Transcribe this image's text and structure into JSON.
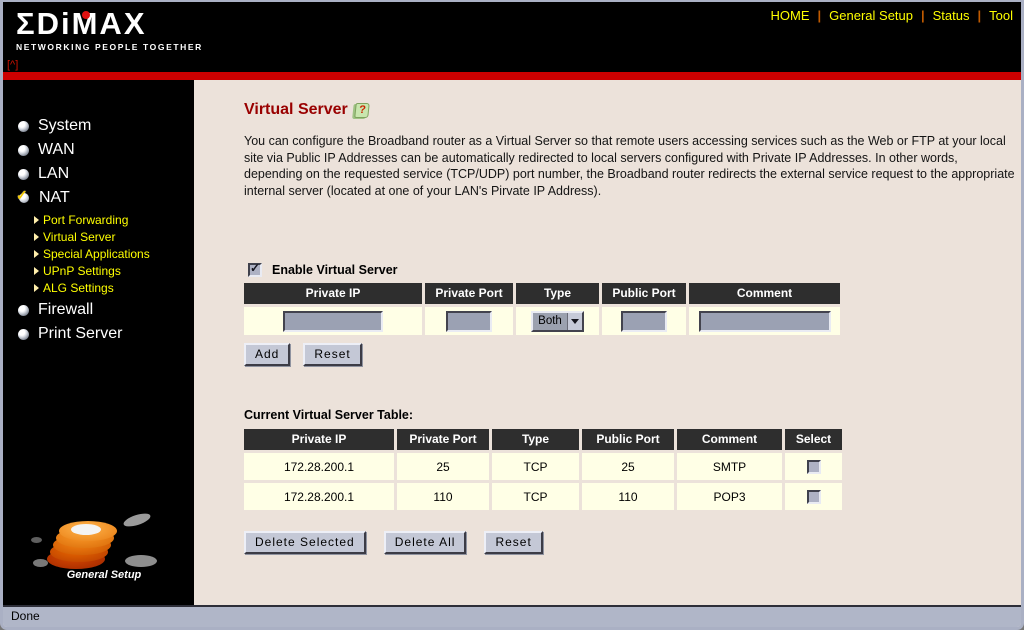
{
  "header": {
    "logo_text": "ΣDiMAX",
    "logo_tagline": "NETWORKING PEOPLE TOGETHER",
    "top_link": "[^]",
    "nav_separator": "|",
    "nav": [
      {
        "label": "HOME"
      },
      {
        "label": "General Setup"
      },
      {
        "label": "Status"
      },
      {
        "label": "Tool"
      }
    ]
  },
  "sidebar": {
    "items_top": [
      {
        "label": "System"
      },
      {
        "label": "WAN"
      },
      {
        "label": "LAN"
      }
    ],
    "nat": {
      "label": "NAT",
      "submenu": [
        {
          "label": "Port Forwarding"
        },
        {
          "label": "Virtual Server"
        },
        {
          "label": "Special Applications"
        },
        {
          "label": "UPnP Settings"
        },
        {
          "label": "ALG Settings"
        }
      ]
    },
    "items_bottom": [
      {
        "label": "Firewall"
      },
      {
        "label": "Print Server"
      }
    ],
    "footer_logo_label": "General Setup"
  },
  "main": {
    "title": "Virtual Server",
    "help_icon_glyph": "?",
    "description": "You can configure the Broadband router as a Virtual Server so that remote users accessing services such as the Web or FTP at your local site via Public IP Addresses can be automatically redirected to local servers configured with Private IP Addresses. In other words, depending on the requested service (TCP/UDP) port number, the Broadband router redirects the external service request to the appropriate internal server (located at one of your LAN's Pirvate IP Address).",
    "enable_checkbox_label": "Enable Virtual Server",
    "input_table": {
      "headers": [
        "Private IP",
        "Private Port",
        "Type",
        "Public Port",
        "Comment"
      ],
      "type_selected": "Both"
    },
    "add_button": "Add",
    "reset_button": "Reset",
    "current_table": {
      "label": "Current Virtual Server Table:",
      "headers": [
        "Private IP",
        "Private Port",
        "Type",
        "Public Port",
        "Comment",
        "Select"
      ],
      "rows": [
        {
          "private_ip": "172.28.200.1",
          "private_port": "25",
          "type": "TCP",
          "public_port": "25",
          "comment": "SMTP"
        },
        {
          "private_ip": "172.28.200.1",
          "private_port": "110",
          "type": "TCP",
          "public_port": "110",
          "comment": "POP3"
        }
      ]
    },
    "delete_selected_button": "Delete Selected",
    "delete_all_button": "Delete All",
    "reset2_button": "Reset"
  },
  "statusbar": {
    "text": "Done"
  },
  "colors": {
    "accent_red": "#cc0000",
    "title_red": "#990000",
    "nav_yellow": "#ffff00",
    "table_header_bg": "#2e2e2e",
    "cell_bg": "#ffffe6",
    "content_bg": "#ece2da"
  }
}
